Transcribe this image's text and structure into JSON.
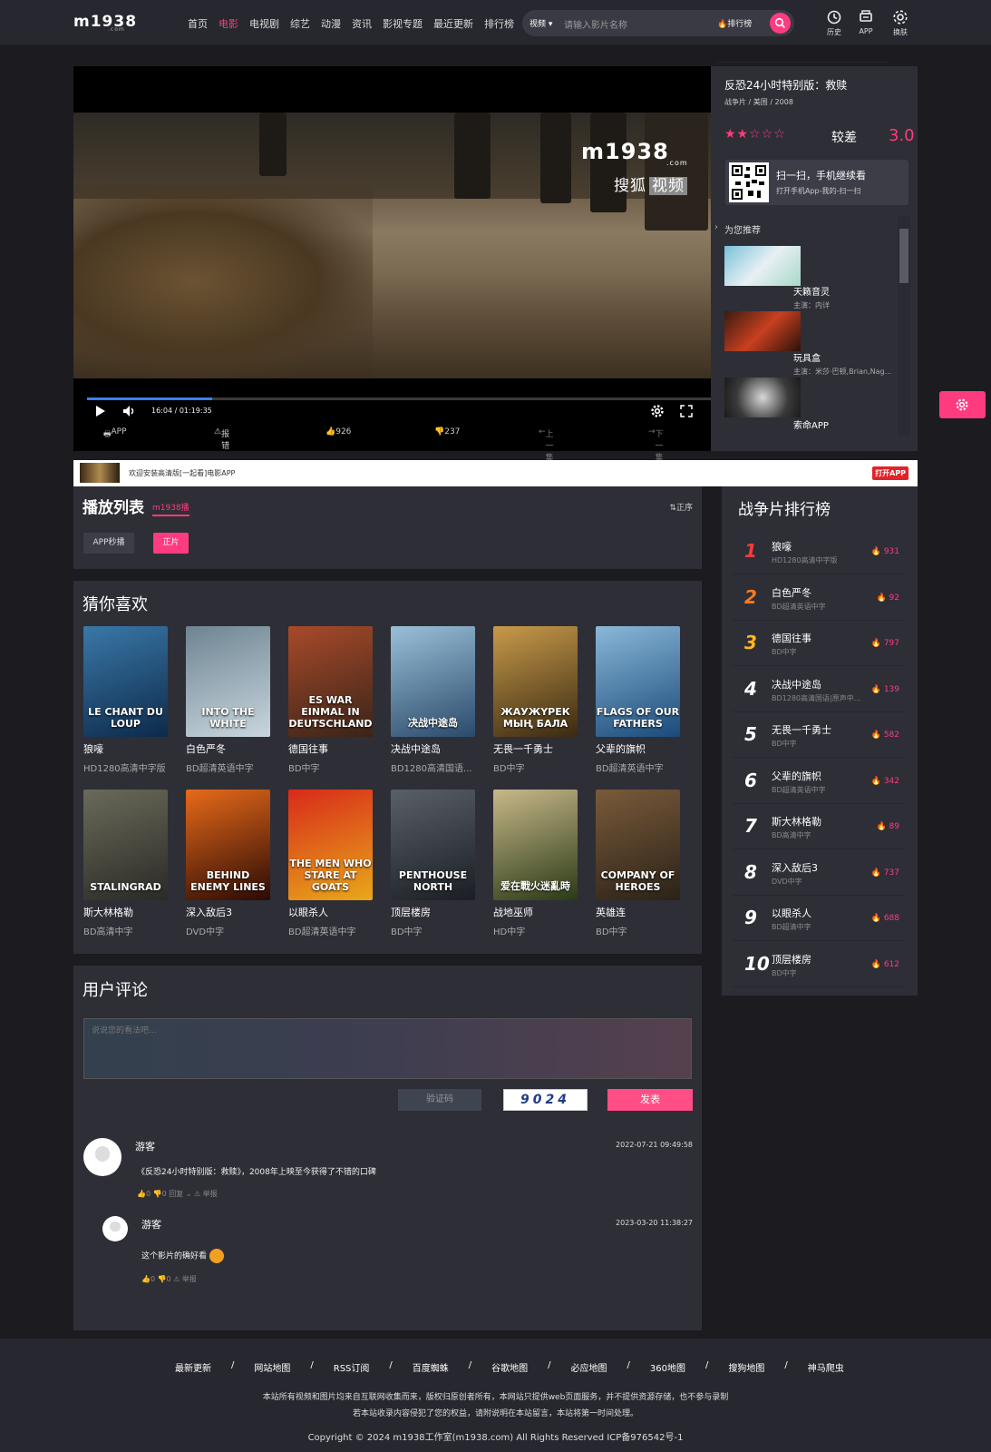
{
  "header": {
    "logo": "m1938",
    "logo_sub": ".com",
    "nav": [
      {
        "label": "首页"
      },
      {
        "label": "电影",
        "active": true
      },
      {
        "label": "电视剧"
      },
      {
        "label": "综艺"
      },
      {
        "label": "动漫"
      },
      {
        "label": "资讯"
      },
      {
        "label": "影视专题"
      },
      {
        "label": "最近更新"
      },
      {
        "label": "排行榜"
      }
    ],
    "search": {
      "category": "视频",
      "placeholder": "请输入影片名称",
      "rank_label": "排行榜"
    },
    "icons": [
      {
        "name": "history-icon",
        "label": "历史"
      },
      {
        "name": "app-icon",
        "label": "APP"
      },
      {
        "name": "skin-icon",
        "label": "换肤"
      }
    ]
  },
  "player": {
    "watermark": "m1938",
    "watermark_sub": ".com",
    "sohu_a": "搜狐",
    "sohu_b": "视频",
    "time": "16:04 / 01:19:35",
    "progress": 0.196,
    "bar": {
      "app": "APP",
      "report": "报错",
      "likes": "926",
      "dislikes": "237",
      "prev": "上一集",
      "next": "下一集"
    }
  },
  "info": {
    "title": "反恐24小时特别版：救赎",
    "meta": "战争片 / 美国 / 2008",
    "stars": "★★☆☆☆",
    "rating_text": "较差",
    "rating": "3.0",
    "qr_a": "扫一扫，手机继续看",
    "qr_b": "打开手机App-我的-扫一扫",
    "rec_label": "为您推荐",
    "rec": [
      {
        "title": "天籁音灵",
        "sub": "主演：内详"
      },
      {
        "title": "玩具盒",
        "sub": "主演：米莎·巴顿,Brian,Nag..."
      },
      {
        "title": "索命APP",
        "sub": ""
      }
    ]
  },
  "banner": {
    "text": "欢迎安装高清版[一起看]电影APP",
    "button": "打开APP"
  },
  "playlist": {
    "title": "播放列表",
    "source": "m1938播",
    "order": "正序",
    "tabs": [
      "APP秒播",
      "正片"
    ]
  },
  "guess": {
    "title": "猜你喜欢",
    "items": [
      {
        "title": "狼嚎",
        "quality": "HD1280高清中字版",
        "poster": "LE CHANT DU LOUP",
        "c1": "#0d2a4a",
        "c2": "#3a78a8"
      },
      {
        "title": "白色严冬",
        "quality": "BD超清英语中字",
        "poster": "INTO THE WHITE",
        "c1": "#c8d6de",
        "c2": "#6e8492"
      },
      {
        "title": "德国往事",
        "quality": "BD中字",
        "poster": "ES WAR EINMAL IN DEUTSCHLAND",
        "c1": "#3a2418",
        "c2": "#a84a2a"
      },
      {
        "title": "决战中途岛",
        "quality": "BD1280高清国语...",
        "poster": "决战中途岛",
        "c1": "#2a4a6a",
        "c2": "#9ac0d8"
      },
      {
        "title": "无畏一千勇士",
        "quality": "BD中字",
        "poster": "ЖАУЖҮРЕК МЫҢ БАЛА",
        "c1": "#3a2a12",
        "c2": "#c89a4a"
      },
      {
        "title": "父辈的旗帜",
        "quality": "BD超清英语中字",
        "poster": "FLAGS OF OUR FATHERS",
        "c1": "#1a4a7a",
        "c2": "#8ab8d8"
      },
      {
        "title": "斯大林格勒",
        "quality": "BD高清中字",
        "poster": "STALINGRAD",
        "c1": "#2a2a26",
        "c2": "#6a6a5a"
      },
      {
        "title": "深入敌后3",
        "quality": "DVD中字",
        "poster": "BEHIND ENEMY LINES",
        "c1": "#2a0a04",
        "c2": "#e86a1a"
      },
      {
        "title": "以眼杀人",
        "quality": "BD超清英语中字",
        "poster": "THE MEN WHO STARE AT GOATS",
        "c1": "#e8a81a",
        "c2": "#d82a1a"
      },
      {
        "title": "顶层楼房",
        "quality": "BD中字",
        "poster": "PENTHOUSE NORTH",
        "c1": "#1a1e24",
        "c2": "#5a6068"
      },
      {
        "title": "战地巫师",
        "quality": "HD中字",
        "poster": "爱在戰火迷亂時",
        "c1": "#2a3a16",
        "c2": "#c8b88a"
      },
      {
        "title": "英雄连",
        "quality": "BD中字",
        "poster": "COMPANY OF HEROES",
        "c1": "#2a2218",
        "c2": "#7a5a3a"
      }
    ]
  },
  "comments": {
    "title": "用户评论",
    "placeholder": "说说您的看法吧...",
    "vcode": "验证码",
    "captcha": "9024",
    "send": "发表",
    "list": [
      {
        "user": "游客",
        "date": "2022-07-21 09:49:58",
        "text": "《反恐24小时特别版：救赎》，2008年上映至今获得了不错的口碑",
        "actions": "👍0  👎0  回复 ⌄   ⚠ 举报"
      },
      {
        "user": "游客",
        "date": "2023-03-20 11:38:27",
        "text": "这个影片的确好看",
        "actions": "👍0  👎0  ⚠ 举报"
      }
    ]
  },
  "rank": {
    "title": "战争片排行榜",
    "items": [
      {
        "n": "1",
        "title": "狼嚎",
        "q": "HD1280高清中字版",
        "hot": "931",
        "color": "#ff3b3b"
      },
      {
        "n": "2",
        "title": "白色严冬",
        "q": "BD超清英语中字",
        "hot": "92",
        "color": "#ff7a1a"
      },
      {
        "n": "3",
        "title": "德国往事",
        "q": "BD中字",
        "hot": "797",
        "color": "#ffb81a"
      },
      {
        "n": "4",
        "title": "决战中途岛",
        "q": "BD1280高清国语|原声中...",
        "hot": "139",
        "color": "#ffffff"
      },
      {
        "n": "5",
        "title": "无畏一千勇士",
        "q": "BD中字",
        "hot": "582",
        "color": "#ffffff"
      },
      {
        "n": "6",
        "title": "父辈的旗帜",
        "q": "BD超清英语中字",
        "hot": "342",
        "color": "#ffffff"
      },
      {
        "n": "7",
        "title": "斯大林格勒",
        "q": "BD高清中字",
        "hot": "89",
        "color": "#ffffff"
      },
      {
        "n": "8",
        "title": "深入敌后3",
        "q": "DVD中字",
        "hot": "737",
        "color": "#ffffff"
      },
      {
        "n": "9",
        "title": "以眼杀人",
        "q": "BD超清中字",
        "hot": "688",
        "color": "#ffffff"
      },
      {
        "n": "10",
        "title": "顶层楼房",
        "q": "BD中字",
        "hot": "612",
        "color": "#ffffff"
      }
    ]
  },
  "footer": {
    "links": [
      "最新更新",
      "网站地图",
      "RSS订阅",
      "百度蜘蛛",
      "谷歌地图",
      "必应地图",
      "360地图",
      "搜狗地图",
      "神马爬虫"
    ],
    "line1": "本站所有视频和图片均来自互联网收集而来，版权归原创者所有，本网站只提供web页面服务，并不提供资源存储，也不参与录制",
    "line2": "若本站收录内容侵犯了您的权益，请附说明在本站留言，本站将第一时间处理。",
    "copyright": "Copyright © 2024 m1938工作室(m1938.com) All Rights Reserved ICP备976542号-1"
  }
}
